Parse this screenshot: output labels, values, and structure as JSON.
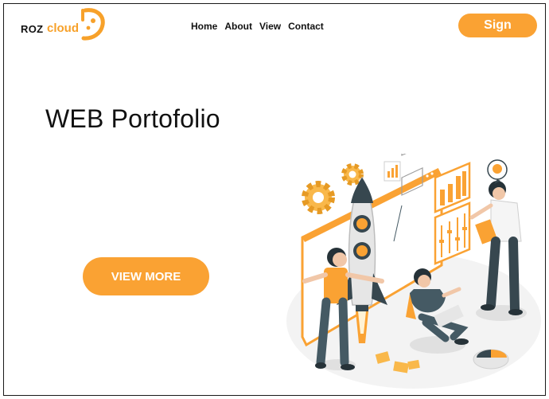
{
  "brand": {
    "part1": "ROZ",
    "part2": "cloud",
    "accent": "#faa233"
  },
  "nav": [
    {
      "label": "Home"
    },
    {
      "label": "About"
    },
    {
      "label": "View"
    },
    {
      "label": "Contact"
    }
  ],
  "header": {
    "sign_label": "Sign"
  },
  "hero": {
    "title": "WEB Portofolio",
    "cta_label": "VIEW MORE"
  },
  "illustration": {
    "subject": "team launching rocket with dashboards",
    "palette": [
      "#faa233",
      "#37474f",
      "#e0e0e0",
      "#ffffff"
    ]
  }
}
